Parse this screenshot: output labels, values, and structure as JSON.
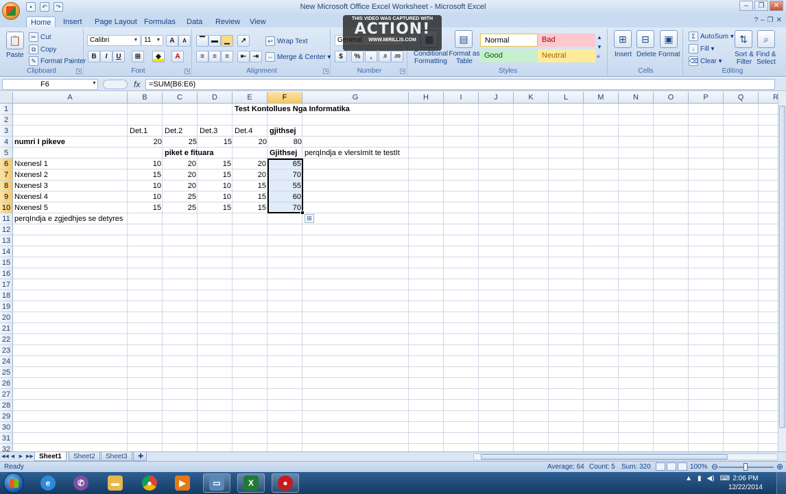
{
  "window": {
    "title": "New Microsoft Office Excel Worksheet - Microsoft Excel",
    "qat": [
      "save-icon",
      "undo-icon",
      "redo-icon"
    ]
  },
  "watermark": {
    "top": "THIS VIDEO WAS CAPTURED WITH",
    "brand": "ACTION!",
    "site": "WWW.MIRILLIS.COM"
  },
  "ribbon": {
    "tabs": [
      "Home",
      "Insert",
      "Page Layout",
      "Formulas",
      "Data",
      "Review",
      "View"
    ],
    "clipboard": {
      "paste": "Paste",
      "cut": "Cut",
      "copy": "Copy",
      "format_painter": "Format Painter",
      "group": "Clipboard"
    },
    "font": {
      "name": "Calibri",
      "size": "11",
      "group": "Font"
    },
    "alignment": {
      "wrap": "Wrap Text",
      "merge": "Merge & Center",
      "group": "Alignment"
    },
    "number": {
      "format": "General",
      "currency": "$",
      "percent": "%",
      "comma": ",",
      "group": "Number"
    },
    "styles": {
      "conditional": "Conditional Formatting",
      "format_table": "Format as Table",
      "normal": "Normal",
      "bad": "Bad",
      "good": "Good",
      "neutral": "Neutral",
      "group": "Styles"
    },
    "cells": {
      "insert": "Insert",
      "delete": "Delete",
      "format": "Format",
      "group": "Cells"
    },
    "editing": {
      "autosum": "AutoSum",
      "fill": "Fill",
      "clear": "Clear",
      "sort": "Sort & Filter",
      "find": "Find & Select",
      "group": "Editing"
    }
  },
  "formula_bar": {
    "name_box": "F6",
    "fx": "fx",
    "formula": "=SUM(B6:E6)"
  },
  "columns": [
    "A",
    "B",
    "C",
    "D",
    "E",
    "F",
    "G",
    "H",
    "I",
    "J",
    "K",
    "L",
    "M",
    "N",
    "O",
    "P",
    "Q",
    "R"
  ],
  "rows": [
    "1",
    "2",
    "3",
    "4",
    "5",
    "6",
    "7",
    "8",
    "9",
    "10",
    "11",
    "12",
    "13",
    "14",
    "15",
    "16",
    "17",
    "18",
    "19",
    "20",
    "21",
    "22",
    "23",
    "24",
    "25",
    "26",
    "27",
    "28",
    "29",
    "30",
    "31",
    "32"
  ],
  "sheet": {
    "title": "Test Kontollues Nga Informatika",
    "headers": [
      "Det.1",
      "Det.2",
      "Det.3",
      "Det.4",
      "gjithsej"
    ],
    "row4_label": "numri I pikeve",
    "row4_values": [
      "20",
      "25",
      "15",
      "20",
      "80"
    ],
    "row5_label": "piket e fituara",
    "row5_f": "Gjithsej",
    "row5_g": "perqIndja e vlersImIt te testIt",
    "students": [
      {
        "name": "Nxenesl 1",
        "values": [
          "10",
          "20",
          "15",
          "20",
          "65"
        ]
      },
      {
        "name": "Nxenesl 2",
        "values": [
          "15",
          "20",
          "15",
          "20",
          "70"
        ]
      },
      {
        "name": "Nxenesl 3",
        "values": [
          "10",
          "20",
          "10",
          "15",
          "55"
        ]
      },
      {
        "name": "Nxenesl 4",
        "values": [
          "10",
          "25",
          "10",
          "15",
          "60"
        ]
      },
      {
        "name": "Nxenesl 5",
        "values": [
          "15",
          "25",
          "15",
          "15",
          "70"
        ]
      }
    ],
    "row11_label": "perqIndja e zgjedhjes se detyres"
  },
  "sheet_tabs": [
    "Sheet1",
    "Sheet2",
    "Sheet3"
  ],
  "status": {
    "mode": "Ready",
    "average": "Average: 64",
    "count": "Count: 5",
    "sum": "Sum: 320",
    "zoom": "100%"
  },
  "taskbar": {
    "time": "2:06 PM",
    "date": "12/22/2014",
    "apps": [
      "ie-icon",
      "viber-icon",
      "explorer-icon",
      "chrome-icon",
      "media-player-icon",
      "window-switcher-icon",
      "excel-icon",
      "action-recorder-icon"
    ]
  }
}
